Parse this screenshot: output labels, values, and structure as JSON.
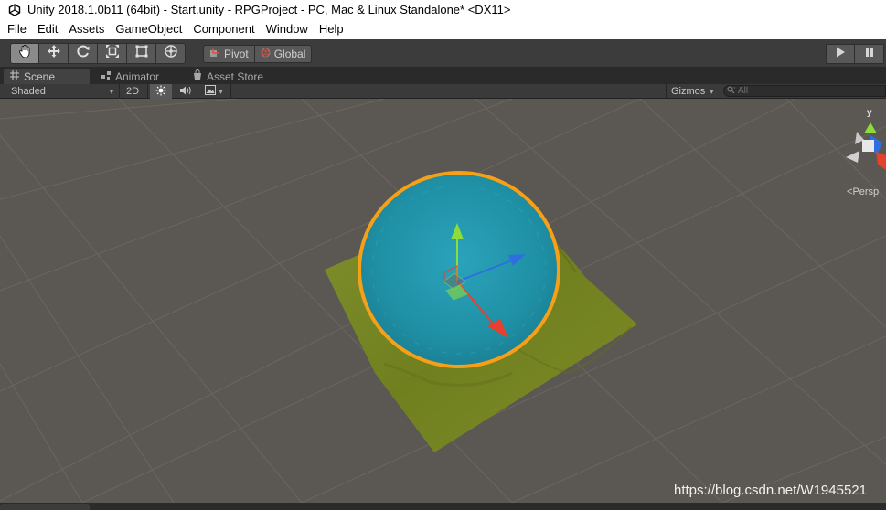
{
  "window": {
    "title": "Unity 2018.1.0b11 (64bit) - Start.unity - RPGProject - PC, Mac & Linux Standalone* <DX11>"
  },
  "menu": [
    "File",
    "Edit",
    "Assets",
    "GameObject",
    "Component",
    "Window",
    "Help"
  ],
  "toolbar": {
    "tools": [
      {
        "icon": "hand-tool-icon",
        "active": true
      },
      {
        "icon": "move-tool-icon",
        "active": false
      },
      {
        "icon": "rotate-tool-icon",
        "active": false
      },
      {
        "icon": "scale-tool-icon",
        "active": false
      },
      {
        "icon": "rect-tool-icon",
        "active": false
      },
      {
        "icon": "transform-tool-icon",
        "active": false
      }
    ],
    "pivot_label": "Pivot",
    "global_label": "Global"
  },
  "tabs": [
    {
      "label": "Scene",
      "icon": "scene-grid-icon",
      "active": true
    },
    {
      "label": "Animator",
      "icon": "animator-icon",
      "active": false
    },
    {
      "label": "Asset Store",
      "icon": "asset-store-icon",
      "active": false
    }
  ],
  "scene_toolbar": {
    "shading_mode": "Shaded",
    "mode_2d_label": "2D",
    "gizmos_label": "Gizmos",
    "search_placeholder": "All"
  },
  "viewport": {
    "projection_label": "Persp",
    "gizmo_y_label": "y",
    "colors": {
      "background": "#5b5752",
      "terrain": "#7b8a2a",
      "water": "#1f8fa4",
      "selection_outline": "#f5a017",
      "axis_x": "#e5412f",
      "axis_y": "#8ddc3c",
      "axis_z": "#2e6fe0"
    }
  },
  "watermark": "https://blog.csdn.net/W1945521"
}
